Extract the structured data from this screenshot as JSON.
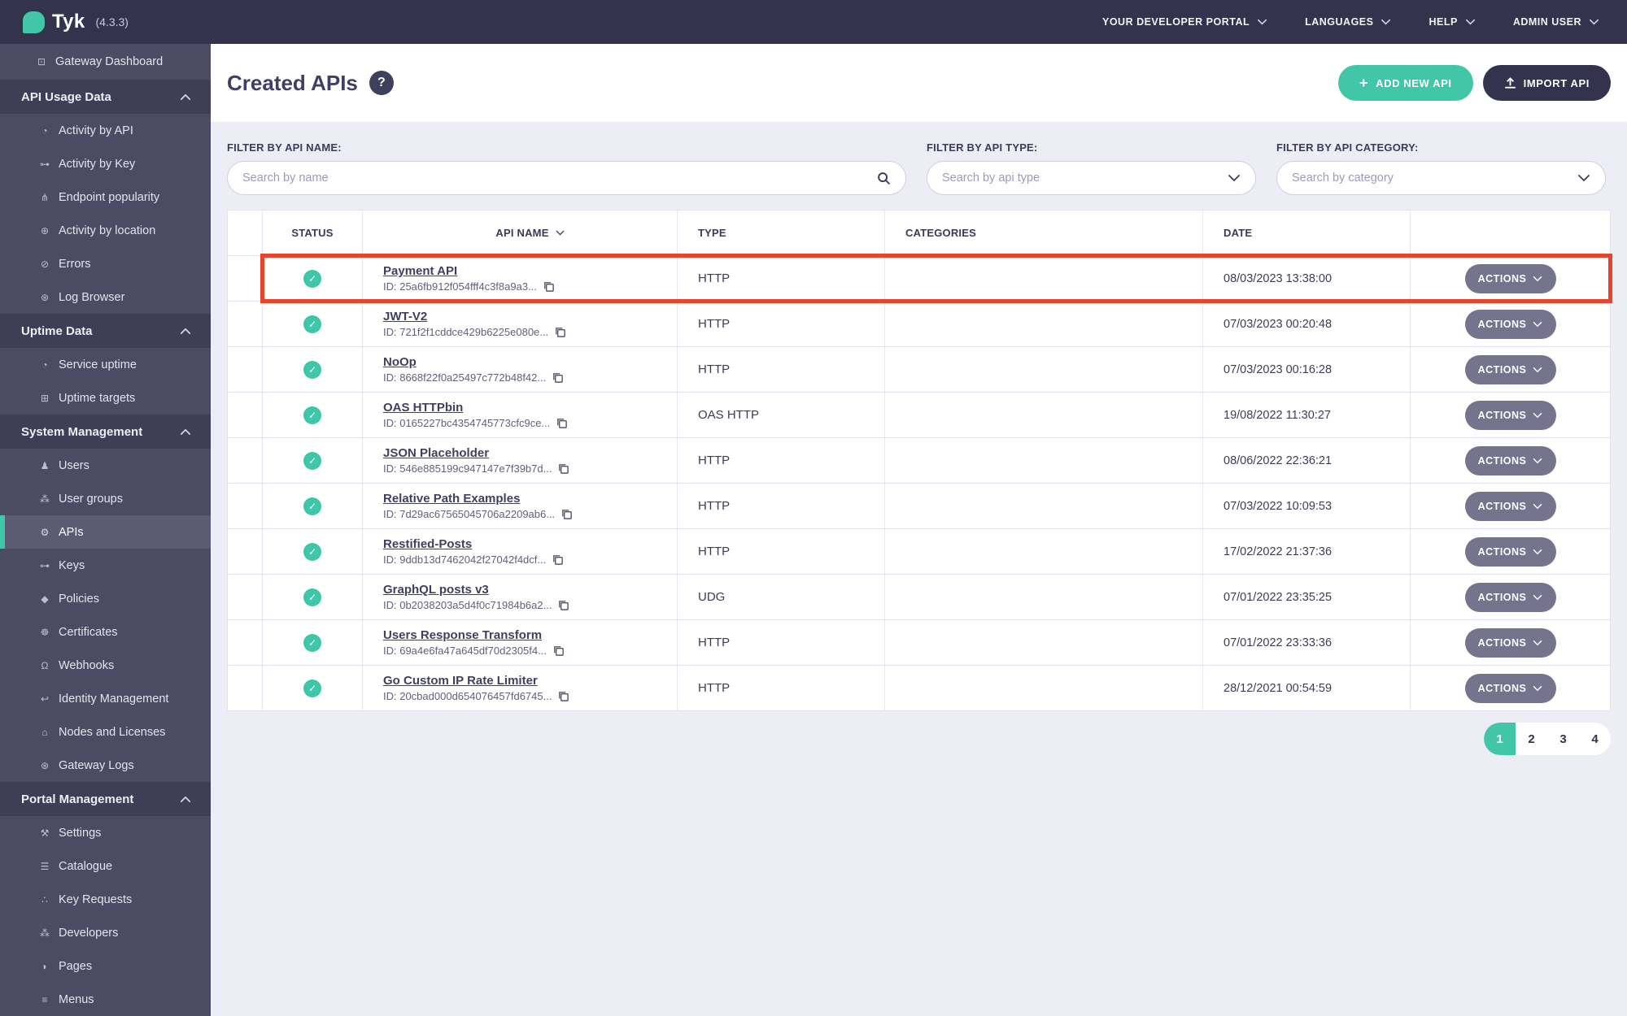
{
  "topbar": {
    "brand": "Tyk",
    "version": "(4.3.3)",
    "menus": [
      {
        "label": "YOUR DEVELOPER PORTAL"
      },
      {
        "label": "LANGUAGES"
      },
      {
        "label": "HELP"
      },
      {
        "label": "ADMIN USER"
      }
    ]
  },
  "sidebar": {
    "entries": [
      {
        "type": "item",
        "label": "Gateway Dashboard",
        "icon": "monitor-icon",
        "glyph": "⊡"
      },
      {
        "type": "header",
        "label": "API Usage Data"
      },
      {
        "type": "item",
        "label": "Activity by API",
        "icon": "gauge-icon",
        "glyph": "◔"
      },
      {
        "type": "item",
        "label": "Activity by Key",
        "icon": "key-icon",
        "glyph": "⊶"
      },
      {
        "type": "item",
        "label": "Endpoint popularity",
        "icon": "branch-icon",
        "glyph": "⋔"
      },
      {
        "type": "item",
        "label": "Activity by location",
        "icon": "globe-icon",
        "glyph": "⊕"
      },
      {
        "type": "item",
        "label": "Errors",
        "icon": "error-icon",
        "glyph": "⊘"
      },
      {
        "type": "item",
        "label": "Log Browser",
        "icon": "bug-icon",
        "glyph": "⊛"
      },
      {
        "type": "header",
        "label": "Uptime Data"
      },
      {
        "type": "item",
        "label": "Service uptime",
        "icon": "uptime-gauge-icon",
        "glyph": "◔"
      },
      {
        "type": "item",
        "label": "Uptime targets",
        "icon": "targets-list-icon",
        "glyph": "⊞"
      },
      {
        "type": "header",
        "label": "System Management"
      },
      {
        "type": "item",
        "label": "Users",
        "icon": "user-icon",
        "glyph": "♟"
      },
      {
        "type": "item",
        "label": "User groups",
        "icon": "user-group-icon",
        "glyph": "⁂"
      },
      {
        "type": "item",
        "label": "APIs",
        "icon": "gears-icon",
        "glyph": "⚙",
        "active": true
      },
      {
        "type": "item",
        "label": "Keys",
        "icon": "key-icon",
        "glyph": "⊶"
      },
      {
        "type": "item",
        "label": "Policies",
        "icon": "policy-icon",
        "glyph": "◆"
      },
      {
        "type": "item",
        "label": "Certificates",
        "icon": "certificate-icon",
        "glyph": "☸"
      },
      {
        "type": "item",
        "label": "Webhooks",
        "icon": "bell-icon",
        "glyph": "Ω"
      },
      {
        "type": "item",
        "label": "Identity Management",
        "icon": "identity-hook-icon",
        "glyph": "↩"
      },
      {
        "type": "item",
        "label": "Nodes and Licenses",
        "icon": "bank-icon",
        "glyph": "⌂"
      },
      {
        "type": "item",
        "label": "Gateway Logs",
        "icon": "bug-icon",
        "glyph": "⊛"
      },
      {
        "type": "header",
        "label": "Portal Management"
      },
      {
        "type": "item",
        "label": "Settings",
        "icon": "wrench-icon",
        "glyph": "⚒"
      },
      {
        "type": "item",
        "label": "Catalogue",
        "icon": "catalogue-icon",
        "glyph": "☰"
      },
      {
        "type": "item",
        "label": "Key Requests",
        "icon": "paw-icon",
        "glyph": "∴"
      },
      {
        "type": "item",
        "label": "Developers",
        "icon": "developers-icon",
        "glyph": "⁂"
      },
      {
        "type": "item",
        "label": "Pages",
        "icon": "leaf-icon",
        "glyph": "◗"
      },
      {
        "type": "item",
        "label": "Menus",
        "icon": "menu-icon",
        "glyph": "≡"
      }
    ]
  },
  "page": {
    "title": "Created APIs",
    "help_label": "?"
  },
  "actions": {
    "add_new_api": "ADD NEW API",
    "import_api": "IMPORT API"
  },
  "filters": [
    {
      "label": "FILTER BY API NAME:",
      "placeholder": "Search by name",
      "control": "search"
    },
    {
      "label": "FILTER BY API TYPE:",
      "placeholder": "Search by api type",
      "control": "select"
    },
    {
      "label": "FILTER BY API CATEGORY:",
      "placeholder": "Search by category",
      "control": "select"
    }
  ],
  "table": {
    "columns": [
      "STATUS",
      "API NAME",
      "TYPE",
      "CATEGORIES",
      "DATE",
      ""
    ],
    "actions_label": "ACTIONS",
    "rows": [
      {
        "name": "Payment API",
        "id_label": "ID: 25a6fb912f054fff4c3f8a9a3...",
        "type": "HTTP",
        "categories": "",
        "date": "08/03/2023 13:38:00",
        "status": "ok",
        "highlighted": true
      },
      {
        "name": "JWT-V2",
        "id_label": "ID: 721f2f1cddce429b6225e080e...",
        "type": "HTTP",
        "categories": "",
        "date": "07/03/2023 00:20:48",
        "status": "ok"
      },
      {
        "name": "NoOp",
        "id_label": "ID: 8668f22f0a25497c772b48f42...",
        "type": "HTTP",
        "categories": "",
        "date": "07/03/2023 00:16:28",
        "status": "ok"
      },
      {
        "name": "OAS HTTPbin",
        "id_label": "ID: 0165227bc4354745773cfc9ce...",
        "type": "OAS HTTP",
        "categories": "",
        "date": "19/08/2022 11:30:27",
        "status": "ok"
      },
      {
        "name": "JSON Placeholder",
        "id_label": "ID: 546e885199c947147e7f39b7d...",
        "type": "HTTP",
        "categories": "",
        "date": "08/06/2022 22:36:21",
        "status": "ok"
      },
      {
        "name": "Relative Path Examples",
        "id_label": "ID: 7d29ac67565045706a2209ab6...",
        "type": "HTTP",
        "categories": "",
        "date": "07/03/2022 10:09:53",
        "status": "ok"
      },
      {
        "name": "Restified-Posts",
        "id_label": "ID: 9ddb13d7462042f27042f4dcf...",
        "type": "HTTP",
        "categories": "",
        "date": "17/02/2022 21:37:36",
        "status": "ok"
      },
      {
        "name": "GraphQL posts v3",
        "id_label": "ID: 0b2038203a5d4f0c71984b6a2...",
        "type": "UDG",
        "categories": "",
        "date": "07/01/2022 23:35:25",
        "status": "ok"
      },
      {
        "name": "Users Response Transform",
        "id_label": "ID: 69a4e6fa47a645df70d2305f4...",
        "type": "HTTP",
        "categories": "",
        "date": "07/01/2022 23:33:36",
        "status": "ok"
      },
      {
        "name": "Go Custom IP Rate Limiter",
        "id_label": "ID: 20cbad000d654076457fd6745...",
        "type": "HTTP",
        "categories": "",
        "date": "28/12/2021 00:54:59",
        "status": "ok"
      }
    ]
  },
  "pagination": {
    "pages": [
      "1",
      "2",
      "3",
      "4"
    ],
    "active": "1"
  },
  "colors": {
    "accent_teal": "#41c6a8",
    "topbar": "#33334d",
    "sidebar": "#4b4b64",
    "sidebar_section": "#3e3e57",
    "panel_background": "#ededf6",
    "highlight_red": "#e8432c",
    "actions_button": "#74748e",
    "dark_button": "#33334e"
  }
}
